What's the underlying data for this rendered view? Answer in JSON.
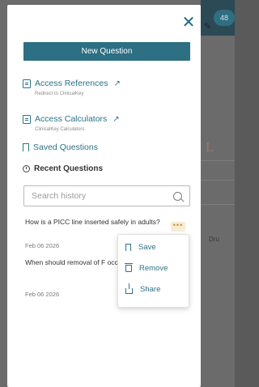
{
  "background": {
    "badge": "48",
    "drug_fragment": "Dru"
  },
  "panel": {
    "close_symbol": "✕",
    "new_question": "New Question",
    "links": [
      {
        "label": "Access References",
        "subtitle": "Redirect to ClinicalKey",
        "arrow": "↗"
      },
      {
        "label": "Access Calculators",
        "subtitle": "ClinicalKey Calculators",
        "arrow": "↗"
      },
      {
        "label": "Saved Questions"
      }
    ],
    "recent_title": "Recent Questions",
    "search": {
      "placeholder": "Search history",
      "value": ""
    },
    "history": [
      {
        "question": "How is a PICC line inserted safely in adults?",
        "date": "Feb 06 2026"
      },
      {
        "question": "When should removal of F occur after pelvic surgery",
        "date": "Feb 06 2026"
      }
    ],
    "more_symbol": "•••",
    "menu": {
      "save": "Save",
      "remove": "Remove",
      "share": "Share"
    }
  },
  "colors": {
    "accent": "#2d6f83",
    "link": "#2c7289",
    "more_bg": "#f8ecd6"
  }
}
